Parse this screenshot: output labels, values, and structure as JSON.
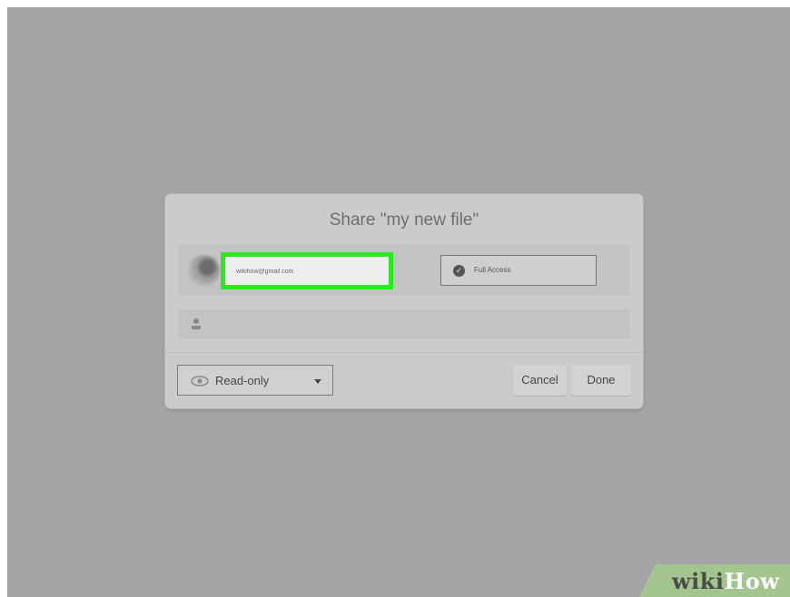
{
  "dialog": {
    "title": "Share \"my new file\"",
    "email_value": "wikihow@gmail.com",
    "access_label": "Full Access",
    "permission_value": "Read-only",
    "cancel_label": "Cancel",
    "done_label": "Done"
  },
  "icons": {
    "avatar": "avatar",
    "access": "check-circle-icon",
    "add_person": "person-icon",
    "permission": "eye-icon",
    "dropdown": "caret-down-icon"
  },
  "colors": {
    "highlight": "#29e91d",
    "backdrop": "#a4a4a4",
    "dialog": "#cbcbcb"
  },
  "watermark": {
    "part1": "wiki",
    "part2": "How"
  }
}
